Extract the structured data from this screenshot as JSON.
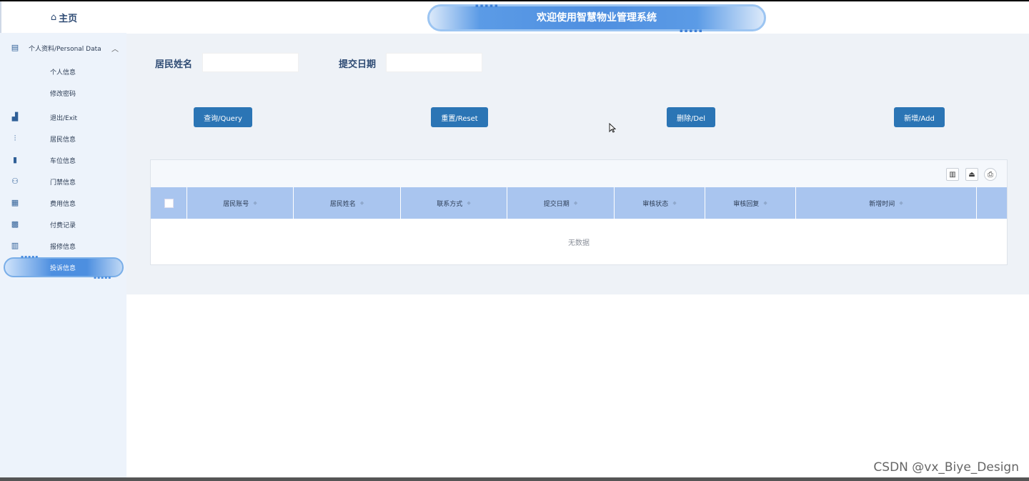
{
  "header": {
    "title": "欢迎使用智慧物业管理系统"
  },
  "sidebar": {
    "home_label": "主页",
    "group": {
      "label": "个人资料/Personal Data",
      "icon": "document-icon"
    },
    "sub_items": [
      "个人信息",
      "修改密码"
    ],
    "items": [
      {
        "label": "退出/Exit",
        "icon": "chart-bar-icon"
      },
      {
        "label": "居民信息",
        "icon": "chart-line-icon"
      },
      {
        "label": "车位信息",
        "icon": "bookmark-icon"
      },
      {
        "label": "门禁信息",
        "icon": "user-badge-icon"
      },
      {
        "label": "费用信息",
        "icon": "calendar-icon"
      },
      {
        "label": "付费记录",
        "icon": "calendar-check-icon"
      },
      {
        "label": "报修信息",
        "icon": "book-icon"
      },
      {
        "label": "投诉信息",
        "icon": "complaint-icon"
      }
    ]
  },
  "filters": {
    "resident_name_label": "居民姓名",
    "resident_name_value": "",
    "submit_date_label": "提交日期",
    "submit_date_value": ""
  },
  "buttons": {
    "query": "查询/Query",
    "reset": "重置/Reset",
    "delete": "删除/Del",
    "add": "新增/Add"
  },
  "table": {
    "columns": [
      "居民账号",
      "居民姓名",
      "联系方式",
      "提交日期",
      "审核状态",
      "审核回复",
      "新增时间"
    ],
    "empty_text": "无数据"
  },
  "watermark": "CSDN @vx_Biye_Design",
  "colors": {
    "primary": "#2b75b5",
    "header_row": "#a9c5ef",
    "sidebar_bg": "#edf3fb"
  }
}
